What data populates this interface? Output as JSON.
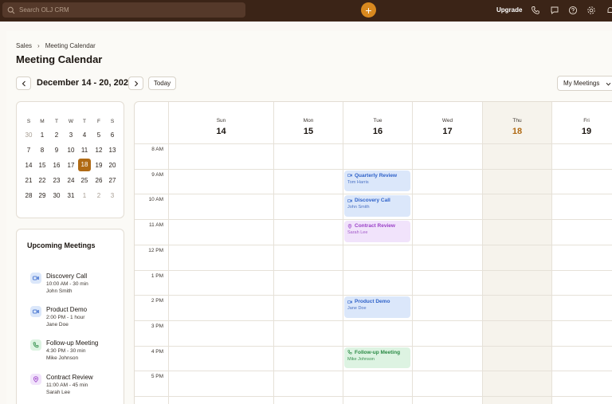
{
  "topbar": {
    "search_placeholder": "Search OLJ CRM",
    "add_label": "+",
    "upgrade_label": "Upgrade"
  },
  "breadcrumb": {
    "parent": "Sales",
    "separator": "›",
    "current": "Meeting Calendar"
  },
  "page_title": "Meeting Calendar",
  "toolbar": {
    "date_range": "December 14 - 20, 2025",
    "today_label": "Today",
    "filter_value": "My Meetings"
  },
  "mini_calendar": {
    "weekday_headers": [
      "S",
      "M",
      "T",
      "W",
      "T",
      "F",
      "S"
    ],
    "weeks": [
      [
        "30",
        "1",
        "2",
        "3",
        "4",
        "5",
        "6"
      ],
      [
        "7",
        "8",
        "9",
        "10",
        "11",
        "12",
        "13"
      ],
      [
        "14",
        "15",
        "16",
        "17",
        "18",
        "19",
        "20"
      ],
      [
        "21",
        "22",
        "23",
        "24",
        "25",
        "26",
        "27"
      ],
      [
        "28",
        "29",
        "30",
        "31",
        "1",
        "2",
        "3"
      ]
    ],
    "selected": "18"
  },
  "upcoming": {
    "title": "Upcoming Meetings",
    "items": [
      {
        "name": "Discovery Call",
        "time": "10:00 AM - 30 min",
        "person": "John Smith",
        "icon": "video-icon",
        "color": "#2f62c9",
        "bg": "#dbe7fa"
      },
      {
        "name": "Product Demo",
        "time": "2:00 PM - 1 hour",
        "person": "Jane Doe",
        "icon": "video-icon",
        "color": "#2f62c9",
        "bg": "#dbe7fa"
      },
      {
        "name": "Follow-up Meeting",
        "time": "4:30 PM - 30 min",
        "person": "Mike Johnson",
        "icon": "phone-icon",
        "color": "#2b8a45",
        "bg": "#ddf3e2"
      },
      {
        "name": "Contract Review",
        "time": "11:00 AM - 45 min",
        "person": "Sarah Lee",
        "icon": "location-icon",
        "color": "#9a3fc7",
        "bg": "#f1e3fb"
      }
    ]
  },
  "week": {
    "days": [
      {
        "dow": "Sun",
        "date": "14"
      },
      {
        "dow": "Mon",
        "date": "15"
      },
      {
        "dow": "Tue",
        "date": "16"
      },
      {
        "dow": "Wed",
        "date": "17"
      },
      {
        "dow": "Thu",
        "date": "18",
        "today": true
      },
      {
        "dow": "Fri",
        "date": "19"
      }
    ],
    "hours": [
      "8 AM",
      "9 AM",
      "10 AM",
      "11 AM",
      "12 PM",
      "1 PM",
      "2 PM",
      "3 PM",
      "4 PM",
      "5 PM"
    ],
    "events": [
      {
        "title": "Quarterly Review",
        "person": "Tom Harris",
        "day": "Tue",
        "start": "9 AM",
        "type": "video",
        "color": "blue"
      },
      {
        "title": "Discovery Call",
        "person": "John Smith",
        "day": "Tue",
        "start": "10 AM",
        "type": "video",
        "color": "blue"
      },
      {
        "title": "Contract Review",
        "person": "Sarah Lee",
        "day": "Tue",
        "start": "11 AM",
        "type": "location",
        "color": "purple"
      },
      {
        "title": "Product Demo",
        "person": "Jane Doe",
        "day": "Tue",
        "start": "2 PM",
        "type": "video",
        "color": "blue"
      },
      {
        "title": "Follow-up Meeting",
        "person": "Mike Johnson",
        "day": "Tue",
        "start": "4 PM",
        "type": "phone",
        "color": "green"
      }
    ]
  },
  "colors": {
    "brand": "#3b2417",
    "accent": "#d9891f",
    "selected_day": "#b06a14"
  }
}
